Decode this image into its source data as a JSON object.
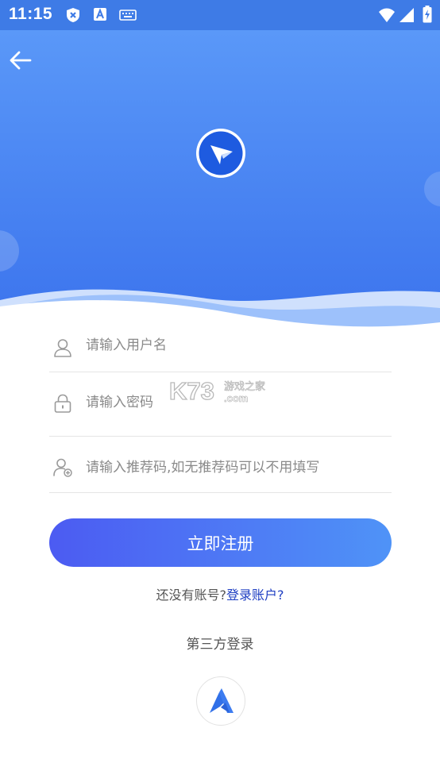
{
  "status_bar": {
    "time": "11:15",
    "background": "#3E7BE6",
    "icons": [
      "close-badge-icon",
      "font-badge-icon",
      "keyboard-icon",
      "wifi-icon",
      "signal-icon",
      "battery-charging-icon"
    ]
  },
  "colors": {
    "hero_top": "#5A98F8",
    "hero_bottom": "#3B73ED",
    "button_start": "#4C5BF2",
    "button_end": "#4F93F7",
    "link": "#1E3EC2"
  },
  "form": {
    "username": {
      "placeholder": "请输入用户名",
      "value": ""
    },
    "password": {
      "placeholder": "请输入密码",
      "value": ""
    },
    "referral": {
      "placeholder": "请输入推荐码,如无推荐码可以不用填写",
      "value": ""
    }
  },
  "register_button": {
    "label": "立即注册"
  },
  "login_prompt": {
    "question": "还没有账号?",
    "link": "登录账户?"
  },
  "third_party": {
    "title": "第三方登录"
  },
  "watermark": {
    "brand": "K73",
    "text_cn": "游戏之家",
    "text_en": ".com"
  }
}
